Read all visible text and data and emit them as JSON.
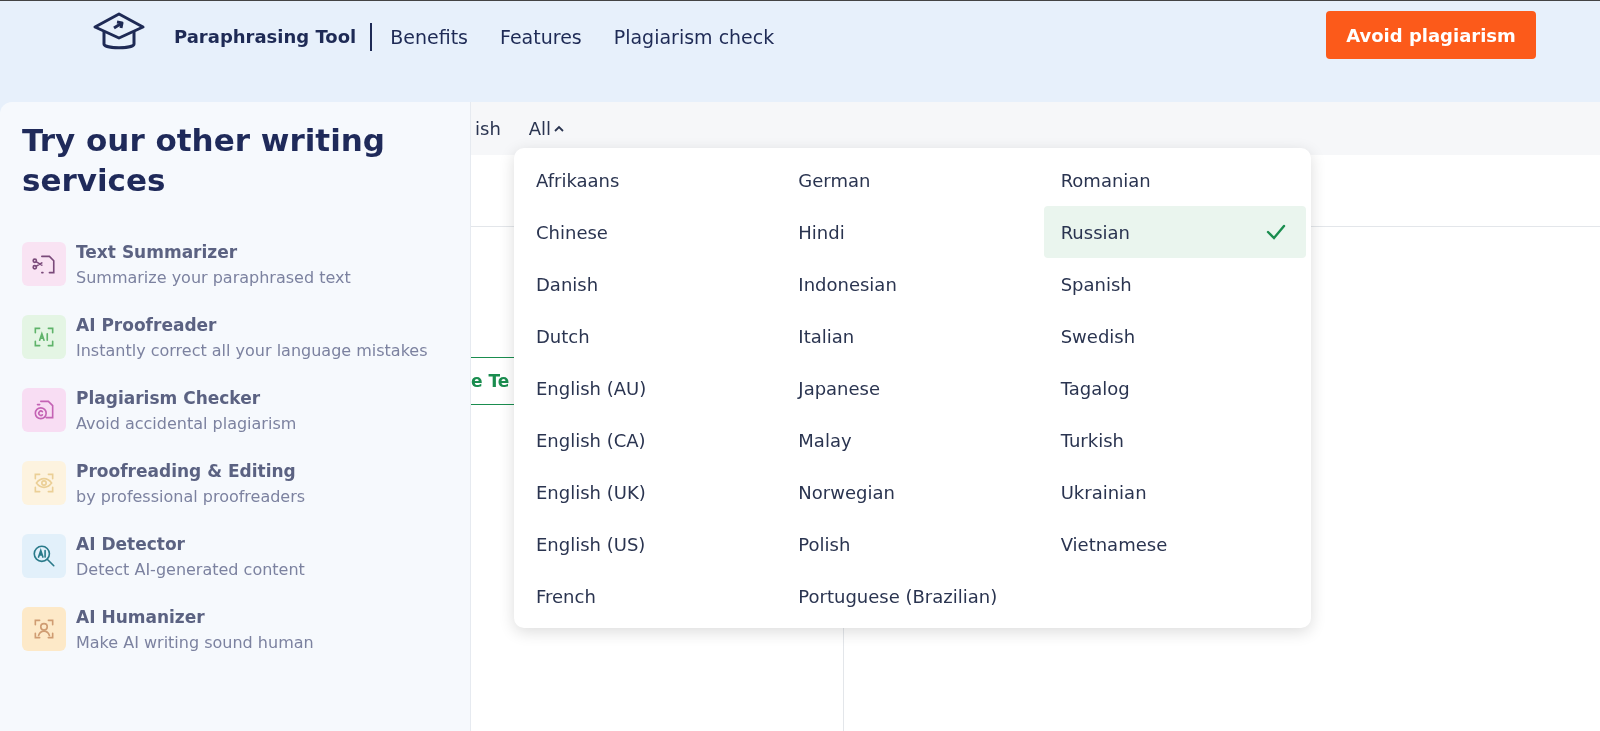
{
  "header": {
    "brand": "Paraphrasing Tool",
    "nav": [
      "Benefits",
      "Features",
      "Plagiarism check"
    ],
    "cta": "Avoid plagiarism"
  },
  "language_bar": {
    "partial_tab": "ish",
    "all_menu": {
      "label": "All",
      "expanded": true
    }
  },
  "mode_button": "e Te",
  "language_dropdown": [
    {
      "label": "Afrikaans",
      "selected": false
    },
    {
      "label": "Chinese",
      "selected": false
    },
    {
      "label": "Danish",
      "selected": false
    },
    {
      "label": "Dutch",
      "selected": false
    },
    {
      "label": "English (AU)",
      "selected": false
    },
    {
      "label": "English (CA)",
      "selected": false
    },
    {
      "label": "English (UK)",
      "selected": false
    },
    {
      "label": "English (US)",
      "selected": false
    },
    {
      "label": "French",
      "selected": false
    },
    {
      "label": "German",
      "selected": false
    },
    {
      "label": "Hindi",
      "selected": false
    },
    {
      "label": "Indonesian",
      "selected": false
    },
    {
      "label": "Italian",
      "selected": false
    },
    {
      "label": "Japanese",
      "selected": false
    },
    {
      "label": "Malay",
      "selected": false
    },
    {
      "label": "Norwegian",
      "selected": false
    },
    {
      "label": "Polish",
      "selected": false
    },
    {
      "label": "Portuguese (Brazilian)",
      "selected": false
    },
    {
      "label": "Romanian",
      "selected": false
    },
    {
      "label": "Russian",
      "selected": true
    },
    {
      "label": "Spanish",
      "selected": false
    },
    {
      "label": "Swedish",
      "selected": false
    },
    {
      "label": "Tagalog",
      "selected": false
    },
    {
      "label": "Turkish",
      "selected": false
    },
    {
      "label": "Ukrainian",
      "selected": false
    },
    {
      "label": "Vietnamese",
      "selected": false
    }
  ],
  "services_panel": {
    "title": "Try our other writing services",
    "items": [
      {
        "kind": "summarizer",
        "color": "#f9e3f3",
        "title": "Text Summarizer",
        "subtitle": "Summarize your paraphrased text"
      },
      {
        "kind": "proofreader",
        "color": "#e4f5e4",
        "title": "AI Proofreader",
        "subtitle": "Instantly correct all your language mistakes"
      },
      {
        "kind": "plagiarism",
        "color": "#f8ddf3",
        "title": "Plagiarism Checker",
        "subtitle": "Avoid accidental plagiarism"
      },
      {
        "kind": "editing",
        "color": "#fdf3df",
        "title": "Proofreading & Editing",
        "subtitle": "by professional proofreaders"
      },
      {
        "kind": "detector",
        "color": "#e2f0fa",
        "title": "AI Detector",
        "subtitle": "Detect AI-generated content"
      },
      {
        "kind": "humanizer",
        "color": "#fde9c8",
        "title": "AI Humanizer",
        "subtitle": "Make AI writing sound human"
      }
    ]
  }
}
